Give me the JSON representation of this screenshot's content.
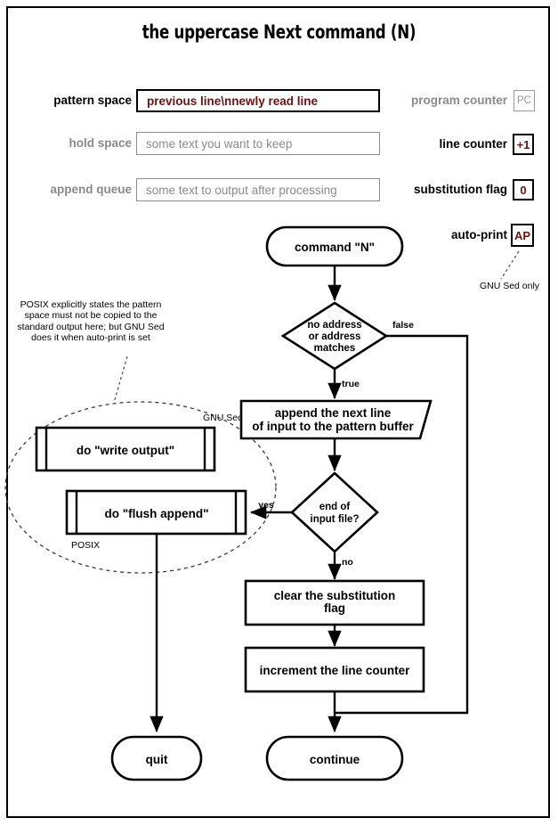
{
  "title": "the uppercase Next command (N)",
  "registers": {
    "left": [
      {
        "label": "pattern space",
        "value": "previous line\\nnewly read line",
        "state": "on"
      },
      {
        "label": "hold space",
        "value": "some text you want to keep",
        "state": "off"
      },
      {
        "label": "append queue",
        "value": "some text to output after processing",
        "state": "off"
      }
    ],
    "right": [
      {
        "label": "program counter",
        "value": "PC",
        "state": "off"
      },
      {
        "label": "line counter",
        "value": "+1",
        "state": "on"
      },
      {
        "label": "substitution flag",
        "value": "0",
        "state": "on"
      },
      {
        "label": "auto-print",
        "value": "AP",
        "state": "on"
      }
    ],
    "autoprint_note": "GNU Sed only"
  },
  "annotation": {
    "posix_note": "POSIX explicitly states the pattern space must not be copied to the standard output here; but GNU Sed does it when auto-print is set",
    "group_top_label": "GNU Sed",
    "group_bottom_label": "POSIX"
  },
  "flow": {
    "start": "command \"N\"",
    "decision_address_l1": "no address",
    "decision_address_l2": "or address",
    "decision_address_l3": "matches",
    "append_line_l1": "append the next line",
    "append_line_l2": "of input to the pattern buffer",
    "decision_eof_l1": "end of",
    "decision_eof_l2": "input file?",
    "clear_flag_l1": "clear the substitution",
    "clear_flag_l2": "flag",
    "increment_counter": "increment the line counter",
    "write_output": "do \"write output\"",
    "flush_append": "do \"flush append\"",
    "quit": "quit",
    "continue": "continue",
    "edge_false": "false",
    "edge_true": "true",
    "edge_yes": "yes",
    "edge_no": "no"
  },
  "colors": {
    "active_value": "#6b1212",
    "inactive": "#8a8a8a",
    "stroke": "#000000"
  }
}
